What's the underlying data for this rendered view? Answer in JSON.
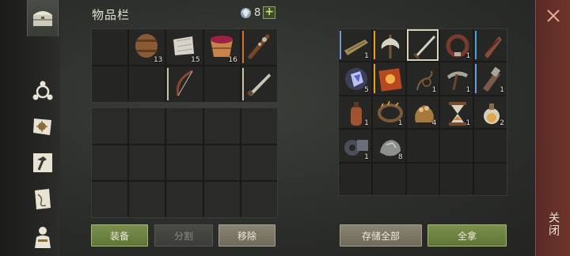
{
  "header": {
    "title": "物品栏",
    "gem_count": "8",
    "plus_label": "+"
  },
  "inventory_top": [
    {
      "name": "empty-slot"
    },
    {
      "name": "barrel",
      "qty": "13"
    },
    {
      "name": "cloth-roll",
      "qty": "15"
    },
    {
      "name": "berry-bucket",
      "qty": "16"
    },
    {
      "name": "spiked-club",
      "bar": "#d2702a"
    },
    {
      "name": "empty-slot"
    },
    {
      "name": "empty-slot"
    },
    {
      "name": "bow",
      "bar": "#c8c3a8"
    },
    {
      "name": "empty-slot"
    },
    {
      "name": "machete",
      "bar": "#c8c3a8"
    }
  ],
  "storage": [
    {
      "name": "wooden-plank",
      "qty": "1",
      "bar": "#6b9bd8"
    },
    {
      "name": "battle-axe",
      "bar": "#e0a12d"
    },
    {
      "name": "sword",
      "selected": true
    },
    {
      "name": "leather-collar",
      "qty": "1"
    },
    {
      "name": "backpack-strap",
      "bar": "#4aa3d8"
    },
    {
      "name": "crystal-ore",
      "qty": "5"
    },
    {
      "name": "red-book",
      "bar": "#e0a12d"
    },
    {
      "name": "rope-whip",
      "qty": "1"
    },
    {
      "name": "pickaxe-head",
      "qty": "1"
    },
    {
      "name": "crossbow-part",
      "qty": "1",
      "bar": "#6b9bd8"
    },
    {
      "name": "leather-flask",
      "qty": "1"
    },
    {
      "name": "thorn-crown",
      "qty": "1"
    },
    {
      "name": "grain-sack",
      "qty": "4"
    },
    {
      "name": "hourglass",
      "qty": "1"
    },
    {
      "name": "potion",
      "qty": "2"
    },
    {
      "name": "metal-cog",
      "qty": "1"
    },
    {
      "name": "stone-ore",
      "qty": "8"
    },
    {
      "name": "empty-slot"
    },
    {
      "name": "empty-slot"
    },
    {
      "name": "empty-slot"
    },
    {
      "name": "empty-slot"
    },
    {
      "name": "empty-slot"
    },
    {
      "name": "empty-slot"
    },
    {
      "name": "empty-slot"
    },
    {
      "name": "empty-slot"
    }
  ],
  "buttons": {
    "equip": "装备",
    "split": "分割",
    "remove": "移除",
    "store_all": "存储全部",
    "take_all": "全拿"
  },
  "close_label": "关闭",
  "colors": {
    "accent_green": "#7b904d",
    "close_panel": "#6e342c"
  }
}
